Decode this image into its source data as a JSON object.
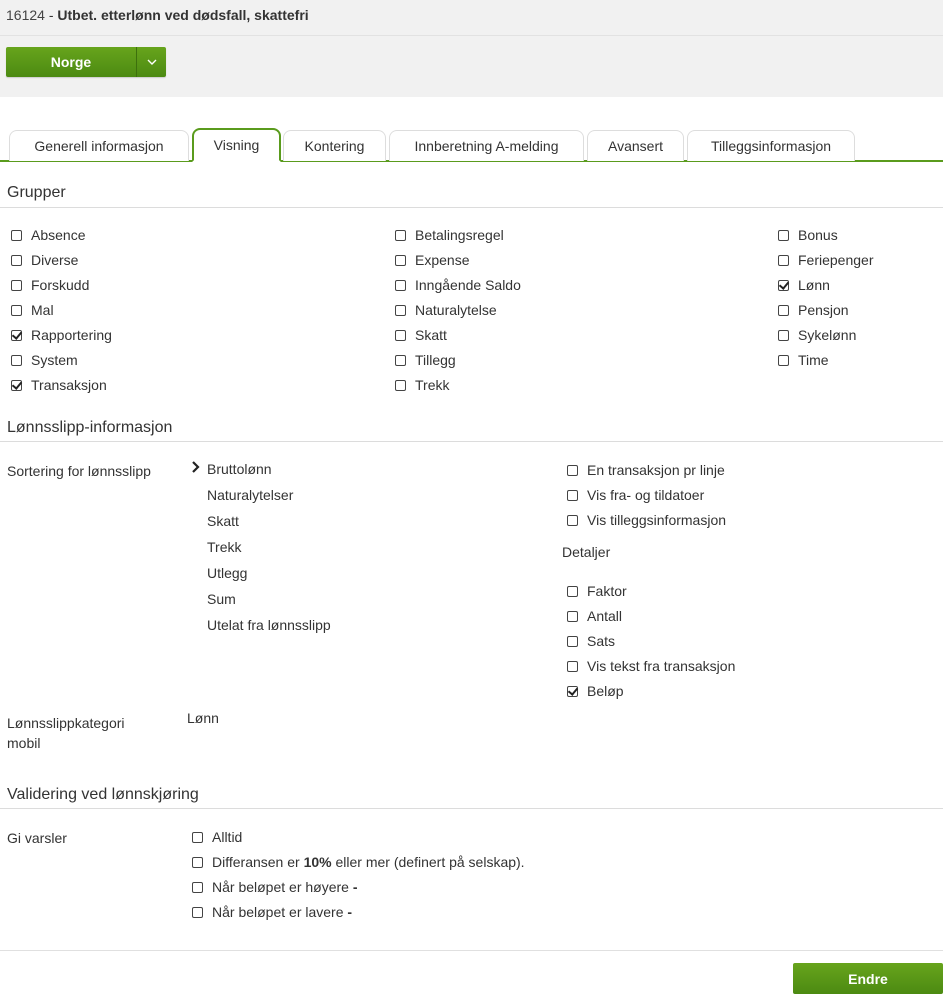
{
  "header": {
    "code": "16124",
    "separator": " - ",
    "name": "Utbet. etterlønn ved dødsfall, skattefri"
  },
  "country_button": {
    "label": "Norge",
    "dropdown_icon": "chevron-down-icon"
  },
  "tabs": [
    {
      "label": "Generell informasjon",
      "active": false
    },
    {
      "label": "Visning",
      "active": true
    },
    {
      "label": "Kontering",
      "active": false
    },
    {
      "label": "Innberetning A-melding",
      "active": false
    },
    {
      "label": "Avansert",
      "active": false
    },
    {
      "label": "Tilleggsinformasjon",
      "active": false
    }
  ],
  "groups": {
    "title": "Grupper",
    "col1": [
      {
        "label": "Absence",
        "checked": false
      },
      {
        "label": "Diverse",
        "checked": false
      },
      {
        "label": "Forskudd",
        "checked": false
      },
      {
        "label": "Mal",
        "checked": false
      },
      {
        "label": "Rapportering",
        "checked": true
      },
      {
        "label": "System",
        "checked": false
      },
      {
        "label": "Transaksjon",
        "checked": true
      }
    ],
    "col2": [
      {
        "label": "Betalingsregel",
        "checked": false
      },
      {
        "label": "Expense",
        "checked": false
      },
      {
        "label": "Inngående Saldo",
        "checked": false
      },
      {
        "label": "Naturalytelse",
        "checked": false
      },
      {
        "label": "Skatt",
        "checked": false
      },
      {
        "label": "Tillegg",
        "checked": false
      },
      {
        "label": "Trekk",
        "checked": false
      }
    ],
    "col3": [
      {
        "label": "Bonus",
        "checked": false
      },
      {
        "label": "Feriepenger",
        "checked": false
      },
      {
        "label": "Lønn",
        "checked": true
      },
      {
        "label": "Pensjon",
        "checked": false
      },
      {
        "label": "Sykelønn",
        "checked": false
      },
      {
        "label": "Time",
        "checked": false
      }
    ]
  },
  "payslip": {
    "title": "Lønnsslipp-informasjon",
    "sort_label": "Sortering for lønnsslipp",
    "sort_items": [
      "Bruttolønn",
      "Naturalytelser",
      "Skatt",
      "Trekk",
      "Utlegg",
      "Sum",
      "Utelat fra lønnsslipp"
    ],
    "options": [
      {
        "label": "En transaksjon pr linje",
        "checked": false
      },
      {
        "label": "Vis fra- og tildatoer",
        "checked": false
      },
      {
        "label": "Vis tilleggsinformasjon",
        "checked": false
      }
    ],
    "details_label": "Detaljer",
    "details": [
      {
        "label": "Faktor",
        "checked": false
      },
      {
        "label": "Antall",
        "checked": false
      },
      {
        "label": "Sats",
        "checked": false
      },
      {
        "label": "Vis tekst fra transaksjon",
        "checked": false
      },
      {
        "label": "Beløp",
        "checked": true
      }
    ],
    "mobile_category_label_line1": "Lønnsslippkategori",
    "mobile_category_label_line2": "mobil",
    "mobile_category_value": "Lønn"
  },
  "validation": {
    "title": "Validering ved lønnskjøring",
    "warn_label": "Gi varsler",
    "options": [
      {
        "label": "Alltid",
        "checked": false
      },
      {
        "pre": "Differansen er ",
        "bold": "10%",
        "post": " eller mer (definert på selskap).",
        "checked": false
      },
      {
        "pre": "Når beløpet er høyere ",
        "bold": "-",
        "post": "",
        "checked": false
      },
      {
        "pre": "Når beløpet er lavere ",
        "bold": "-",
        "post": "",
        "checked": false
      }
    ]
  },
  "actions": {
    "edit_label": "Endre"
  },
  "colors": {
    "accent_green": "#5a9b1d",
    "button_green": "#4c8a12",
    "header_bg": "#f1f1f1"
  }
}
